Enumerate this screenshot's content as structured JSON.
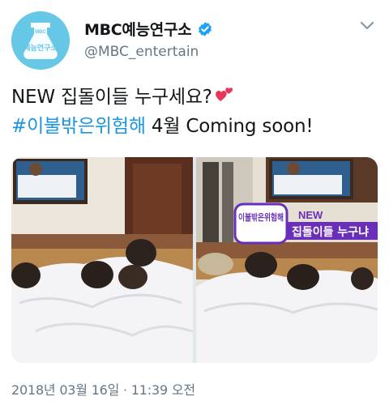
{
  "account": {
    "display_name": "MBC예능연구소",
    "handle": "@MBC_entertain",
    "avatar_text": "예능연구소",
    "avatar_small": "MBC"
  },
  "tweet": {
    "line1": "NEW 집돌이들 누구세요?",
    "hashtag": "#이불밖은위험해",
    "line2_rest": " 4월 Coming soon!"
  },
  "media": {
    "overlay_logo": "이불밖은위험해",
    "overlay_new": "NEW",
    "overlay_title": "집돌이들 누구냐"
  },
  "timestamp": "2018년 03월 16일 · 11:39 오전",
  "colors": {
    "link": "#1b95e0",
    "verified": "#1da1f2",
    "secondary": "#657786",
    "avatar_bg": "#66c8e6",
    "overlay_purple": "#6a2fb8"
  },
  "icons": [
    "verified-badge-icon",
    "chevron-down-icon",
    "two-hearts-emoji"
  ]
}
